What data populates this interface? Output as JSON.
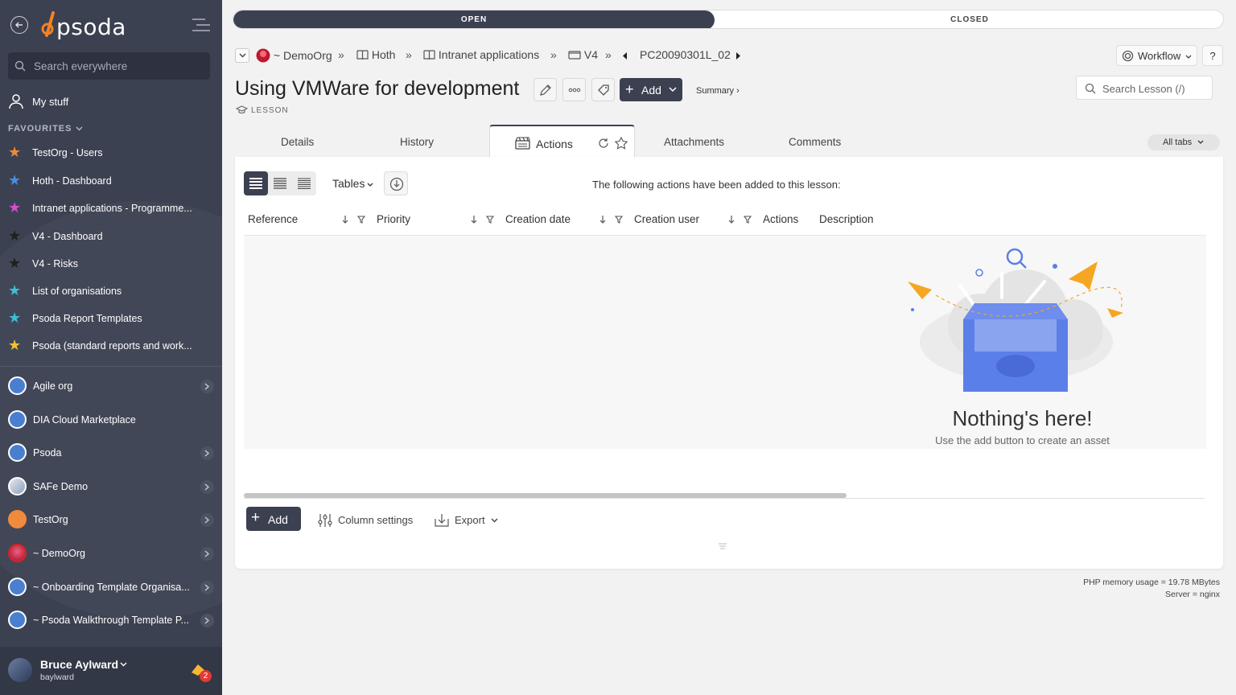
{
  "sidebar": {
    "logo_text": "psoda",
    "search_placeholder": "Search everywhere",
    "my_stuff": "My stuff",
    "favourites_heading": "FAVOURITES",
    "favourites": [
      {
        "label": "TestOrg - Users",
        "color": "#f08a3c"
      },
      {
        "label": "Hoth - Dashboard",
        "color": "#4a8de0"
      },
      {
        "label": "Intranet applications - Programme...",
        "color": "#d04fd0"
      },
      {
        "label": "V4 - Dashboard",
        "color": "#222222"
      },
      {
        "label": "V4 - Risks",
        "color": "#222222"
      },
      {
        "label": "List of organisations",
        "color": "#3bbfd8"
      },
      {
        "label": "Psoda Report Templates",
        "color": "#3bbfd8"
      },
      {
        "label": "Psoda (standard reports and work...",
        "color": "#f2c230"
      }
    ],
    "orgs": [
      {
        "label": "Agile org",
        "has_chevron": true
      },
      {
        "label": "DIA Cloud Marketplace",
        "has_chevron": false
      },
      {
        "label": "Psoda",
        "has_chevron": true
      },
      {
        "label": "SAFe Demo",
        "has_chevron": true
      },
      {
        "label": "TestOrg",
        "has_chevron": true
      },
      {
        "label": "~ DemoOrg",
        "has_chevron": true
      },
      {
        "label": "~ Onboarding Template Organisa...",
        "has_chevron": true
      },
      {
        "label": "~ Psoda Walkthrough Template P...",
        "has_chevron": true
      }
    ],
    "user": {
      "name": "Bruce Aylward",
      "login": "baylward",
      "notifications": "2"
    }
  },
  "status": {
    "open": "OPEN",
    "closed": "CLOSED"
  },
  "breadcrumb": {
    "items": [
      "~ DemoOrg",
      "Hoth",
      "Intranet applications",
      "V4",
      "PC20090301L_02"
    ],
    "separator": "»"
  },
  "header": {
    "title": "Using VMWare for development",
    "type_label": "LESSON",
    "add_label": "Add",
    "summary_label": "Summary ›",
    "workflow_label": "Workflow",
    "help_label": "?",
    "search_placeholder": "Search Lesson (/)"
  },
  "tabs": {
    "items": [
      "Details",
      "History",
      "Actions",
      "Attachments",
      "Comments"
    ],
    "active": "Actions",
    "all_tabs": "All tabs"
  },
  "actions_panel": {
    "view_label": "Tables",
    "intro": "The following actions have been added to this lesson:",
    "columns": [
      "Reference",
      "Priority",
      "Creation date",
      "Creation user",
      "Actions",
      "Description"
    ],
    "empty_title": "Nothing's here!",
    "empty_subtitle": "Use the add button to create an asset",
    "add_label": "Add",
    "column_settings": "Column settings",
    "export": "Export"
  },
  "footer": {
    "memory": "PHP memory usage = 19.78 MBytes",
    "server": "Server = nginx"
  },
  "colors": {
    "sidebar_bg": "#3c4151",
    "accent_dark": "#3c4151",
    "empty_blue": "#5b7fe8",
    "empty_orange": "#f5a623"
  }
}
